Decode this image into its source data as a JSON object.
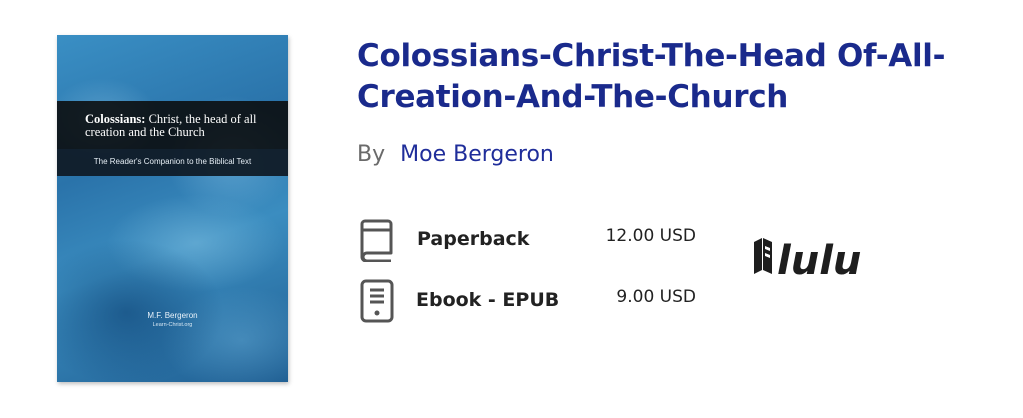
{
  "book": {
    "cover": {
      "title_bold": "Colossians:",
      "title_rest": " Christ, the head of all creation and the Church",
      "subtitle": "The Reader's Companion to the Biblical Text",
      "author": "M.F. Bergeron",
      "site": "Learn-Christ.org"
    },
    "title": "Colossians-Christ-The-Head Of-All-Creation-And-The-Church",
    "by_label": "By",
    "author": "Moe Bergeron"
  },
  "formats": [
    {
      "icon": "book-icon",
      "name": "Paperback",
      "price": "12.00 USD"
    },
    {
      "icon": "tablet-icon",
      "name": "Ebook - EPUB",
      "price": "9.00 USD"
    }
  ],
  "publisher": {
    "logo_text": "lulu",
    "icon": "lulu-logo"
  },
  "colors": {
    "title": "#1a2a8c",
    "author_link": "#1f2d9a",
    "icon_gray": "#555555"
  }
}
